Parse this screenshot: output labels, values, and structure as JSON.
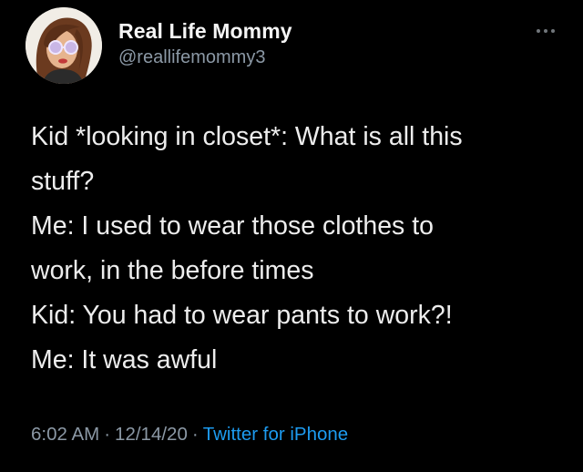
{
  "author": {
    "display_name": "Real Life Mommy",
    "handle": "@reallifemommy3",
    "avatar_icon": "cartoon-woman-avatar"
  },
  "tweet": {
    "lines": [
      "Kid *looking in closet*: What is all this",
      "stuff?",
      "Me: I used to wear those clothes to",
      "work, in the before times",
      "Kid: You had to wear pants to work?!",
      "Me: It was awful"
    ],
    "time": "6:02 AM",
    "separator": "·",
    "date": "12/14/20",
    "source": "Twitter for iPhone"
  },
  "icons": {
    "more": "more-options-icon"
  },
  "colors": {
    "background": "#000000",
    "text": "#e7e9ea",
    "secondary": "#8b98a5",
    "link": "#1d9bf0"
  }
}
